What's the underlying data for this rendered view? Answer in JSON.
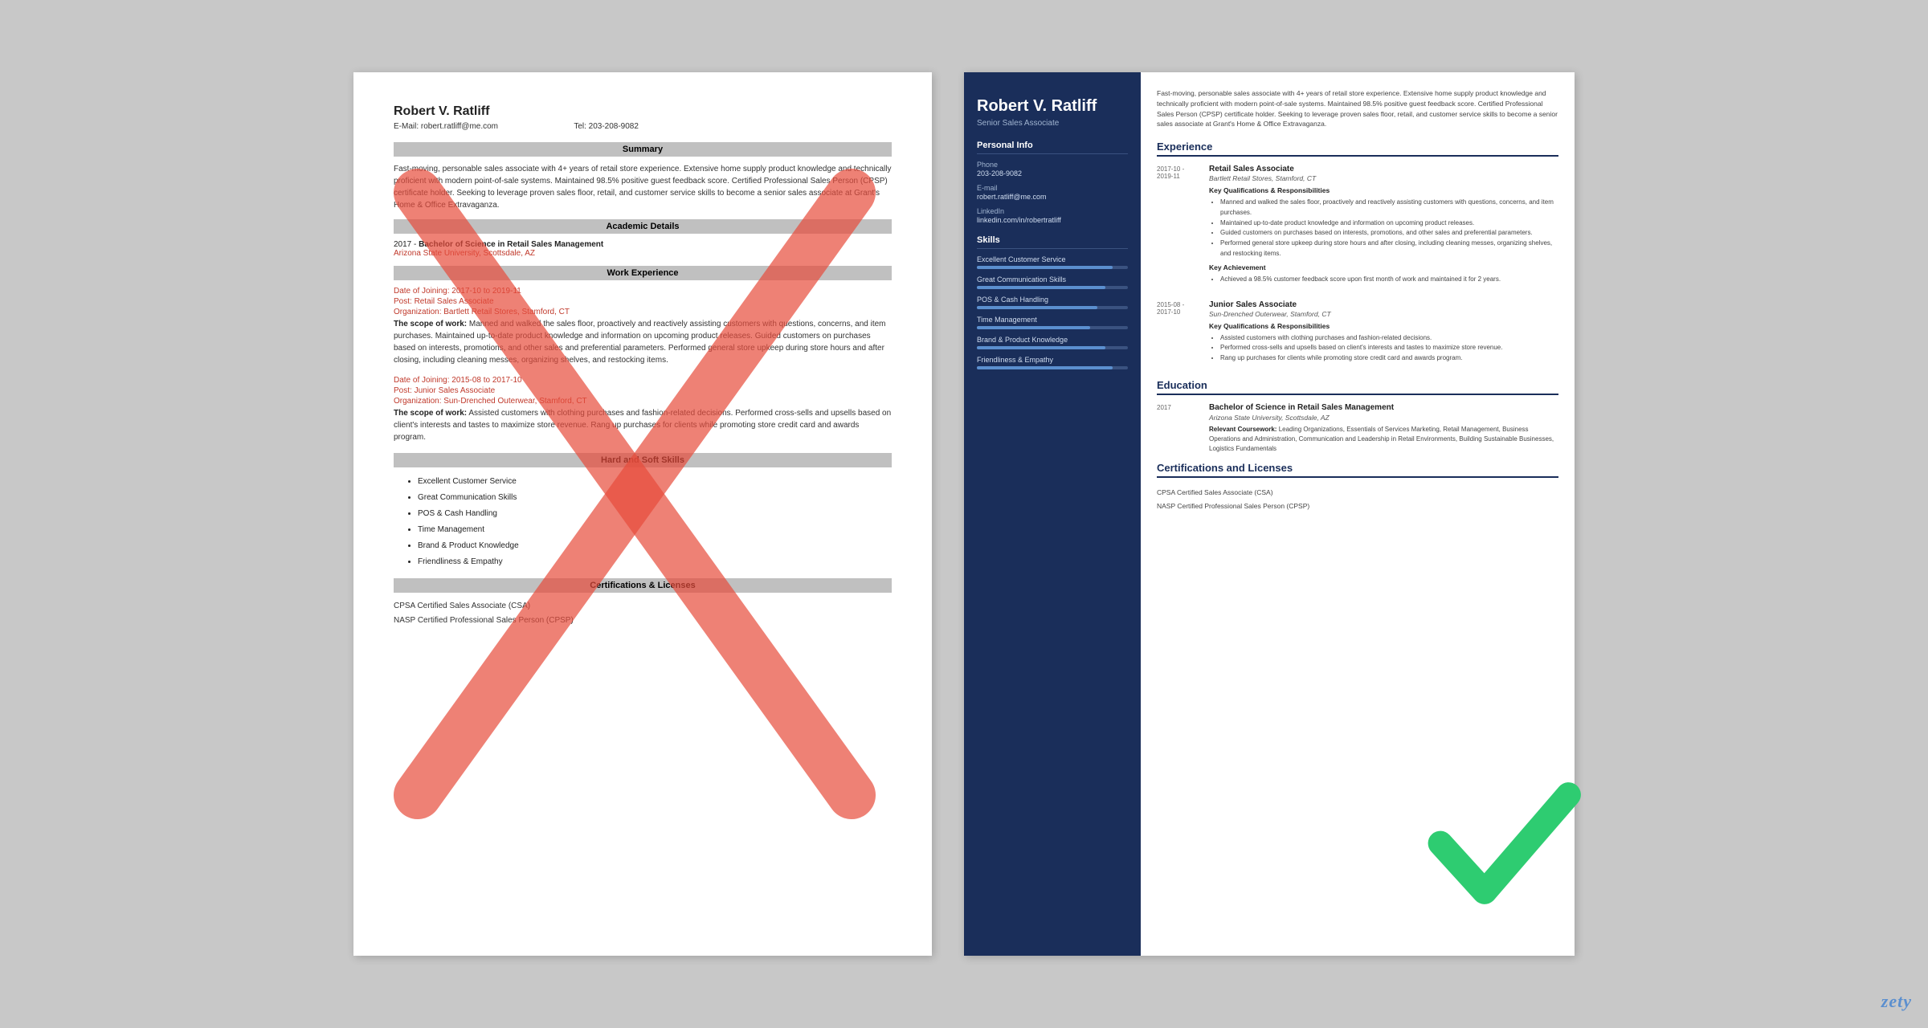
{
  "left_resume": {
    "name": "Robert V. Ratliff",
    "email_label": "E-Mail:",
    "email": "robert.ratliff@me.com",
    "tel_label": "Tel:",
    "tel": "203-208-9082",
    "sections": {
      "summary": {
        "heading": "Summary",
        "text": "Fast-moving, personable sales associate with 4+ years of retail store experience. Extensive home supply product knowledge and technically proficient with modern point-of-sale systems. Maintained 98.5% positive guest feedback score. Certified Professional Sales Person (CPSP) certificate holder. Seeking to leverage proven sales floor, retail, and customer service skills to become a senior sales associate at Grant's Home & Office Extravaganza."
      },
      "academic": {
        "heading": "Academic Details",
        "year": "2017 -",
        "degree": "Bachelor of Science in Retail Sales Management",
        "school": "Arizona State University, Scottsdale, AZ"
      },
      "work": {
        "heading": "Work Experience",
        "entries": [
          {
            "date": "Date of Joining: 2017-10 to 2019-11",
            "post": "Post: Retail Sales Associate",
            "org": "Organization: Bartlett Retail Stores, Stamford, CT",
            "scope_label": "The scope of work:",
            "scope_text": "Manned and walked the sales floor, proactively and reactively assisting customers with questions, concerns, and item purchases. Maintained up-to-date product knowledge and information on upcoming product releases. Guided customers on purchases based on interests, promotions, and other sales and preferential parameters. Performed general store upkeep during store hours and after closing, including cleaning messes, organizing shelves, and restocking items."
          },
          {
            "date": "Date of Joining: 2015-08 to 2017-10",
            "post": "Post: Junior Sales Associate",
            "org": "Organization: Sun-Drenched Outerwear, Stamford, CT",
            "scope_label": "The scope of work:",
            "scope_text": "Assisted customers with clothing purchases and fashion-related decisions. Performed cross-sells and upsells based on client's interests and tastes to maximize store revenue. Rang up purchases for clients while promoting store credit card and awards program."
          }
        ]
      },
      "skills": {
        "heading": "Hard and Soft Skills",
        "items": [
          "Excellent Customer Service",
          "Great Communication Skills",
          "POS & Cash Handling",
          "Time Management",
          "Brand & Product Knowledge",
          "Friendliness & Empathy"
        ]
      },
      "certs": {
        "heading": "Certifications & Licenses",
        "items": [
          "CPSA Certified Sales Associate (CSA)",
          "NASP Certified Professional Sales Person (CPSP)"
        ]
      }
    }
  },
  "right_resume": {
    "name": "Robert V. Ratliff",
    "job_title": "Senior Sales Associate",
    "sidebar": {
      "personal_info_heading": "Personal Info",
      "phone_label": "Phone",
      "phone": "203-208-9082",
      "email_label": "E-mail",
      "email": "robert.ratliff@me.com",
      "linkedin_label": "LinkedIn",
      "linkedin": "linkedin.com/in/robertratliff",
      "skills_heading": "Skills",
      "skills": [
        {
          "label": "Excellent Customer Service",
          "pct": 90
        },
        {
          "label": "Great Communication Skills",
          "pct": 85
        },
        {
          "label": "POS & Cash Handling",
          "pct": 80
        },
        {
          "label": "Time Management",
          "pct": 75
        },
        {
          "label": "Brand & Product Knowledge",
          "pct": 85
        },
        {
          "label": "Friendliness & Empathy",
          "pct": 90
        }
      ]
    },
    "summary": "Fast-moving, personable sales associate with 4+ years of retail store experience. Extensive home supply product knowledge and technically proficient with modern point-of-sale systems. Maintained 98.5% positive guest feedback score. Certified Professional Sales Person (CPSP) certificate holder. Seeking to leverage proven sales floor, retail, and customer service skills to become a senior sales associate at Grant's Home & Office Extravaganza.",
    "experience_heading": "Experience",
    "experience": [
      {
        "dates": "2017-10 - 2019-11",
        "title": "Retail Sales Associate",
        "company": "Bartlett Retail Stores, Stamford, CT",
        "kq_heading": "Key Qualifications & Responsibilities",
        "bullets": [
          "Manned and walked the sales floor, proactively and reactively assisting customers with questions, concerns, and item purchases.",
          "Maintained up-to-date product knowledge and information on upcoming product releases.",
          "Guided customers on purchases based on interests, promotions, and other sales and preferential parameters.",
          "Performed general store upkeep during store hours and after closing, including cleaning messes, organizing shelves, and restocking items."
        ],
        "achievement_heading": "Key Achievement",
        "achievements": [
          "Achieved a 98.5% customer feedback score upon first month of work and maintained it for 2 years."
        ]
      },
      {
        "dates": "2015-08 - 2017-10",
        "title": "Junior Sales Associate",
        "company": "Sun-Drenched Outerwear, Stamford, CT",
        "kq_heading": "Key Qualifications & Responsibilities",
        "bullets": [
          "Assisted customers with clothing purchases and fashion-related decisions.",
          "Performed cross-sells and upsells based on client's interests and tastes to maximize store revenue.",
          "Rang up purchases for clients while promoting store credit card and awards program."
        ]
      }
    ],
    "education_heading": "Education",
    "education": [
      {
        "year": "2017",
        "degree": "Bachelor of Science in Retail Sales Management",
        "school": "Arizona State University, Scottsdale, AZ",
        "coursework_label": "Relevant Coursework:",
        "coursework": "Leading Organizations, Essentials of Services Marketing, Retail Management, Business Operations and Administration, Communication and Leadership in Retail Environments, Building Sustainable Businesses, Logistics Fundamentals"
      }
    ],
    "certs_heading": "Certifications and Licenses",
    "certs": [
      "CPSA Certified Sales Associate (CSA)",
      "NASP Certified Professional Sales Person (CPSP)"
    ]
  },
  "watermark": "zety"
}
